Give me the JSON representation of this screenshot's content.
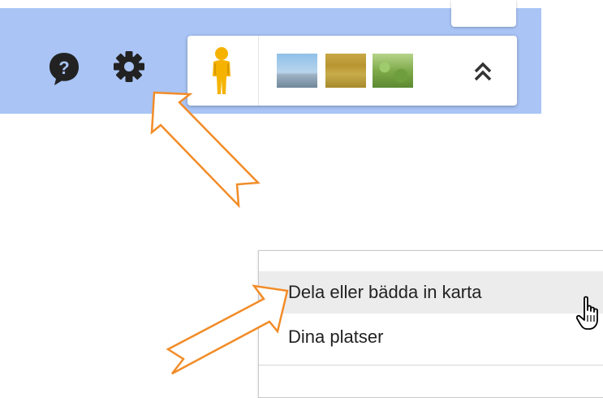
{
  "map_controls": {
    "help_icon": "help-bubble-icon",
    "settings_icon": "gear-icon",
    "pegman_icon": "pegman-icon",
    "expand_icon": "double-chevron-up-icon",
    "thumbnails": [
      {
        "name": "imagery-thumbnail-coast",
        "icon": "landscape-thumbnail"
      },
      {
        "name": "imagery-thumbnail-field",
        "icon": "landscape-thumbnail"
      },
      {
        "name": "imagery-thumbnail-trees",
        "icon": "landscape-thumbnail"
      }
    ]
  },
  "settings_menu": {
    "items": [
      {
        "label": "Dela eller bädda in karta",
        "state": "hover"
      },
      {
        "label": "Dina platser",
        "state": "normal"
      }
    ]
  },
  "annotations": {
    "arrow_color": "#f28c28",
    "arrows": [
      "arrow-to-settings",
      "arrow-to-share-menu-item"
    ]
  },
  "colors": {
    "map_background": "#a9c4f5",
    "menu_hover": "#ececec"
  }
}
